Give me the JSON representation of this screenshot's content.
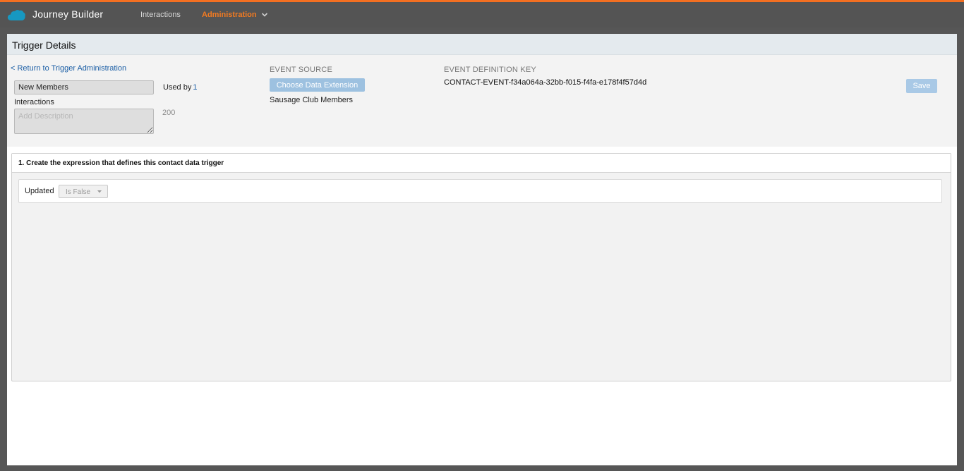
{
  "app": {
    "title": "Journey Builder",
    "accent_color": "#f36f21",
    "logo_icon": "salesforce-cloud-icon"
  },
  "nav": {
    "items": [
      {
        "label": "Interactions",
        "active": false
      },
      {
        "label": "Administration",
        "active": true
      }
    ],
    "dropdown_icon": "chevron-down-icon"
  },
  "page": {
    "title": "Trigger Details"
  },
  "details": {
    "return_link": "< Return to Trigger Administration",
    "name_value": "New Members",
    "used_by_label": "Used by",
    "used_by_count": "1",
    "interactions_label": "Interactions",
    "description_placeholder": "Add Description",
    "char_count": "200",
    "event_source_label": "EVENT SOURCE",
    "choose_button_label": "Choose Data Extension",
    "source_name": "Sausage Club Members",
    "event_key_label": "EVENT DEFINITION KEY",
    "event_key_value": "CONTACT-EVENT-f34a064a-32bb-f015-f4fa-e178f4f57d4d",
    "save_label": "Save"
  },
  "expression": {
    "title": "1. Create the expression that defines this contact data trigger",
    "conditions": [
      {
        "field": "Updated",
        "operator": "Is False"
      }
    ]
  }
}
